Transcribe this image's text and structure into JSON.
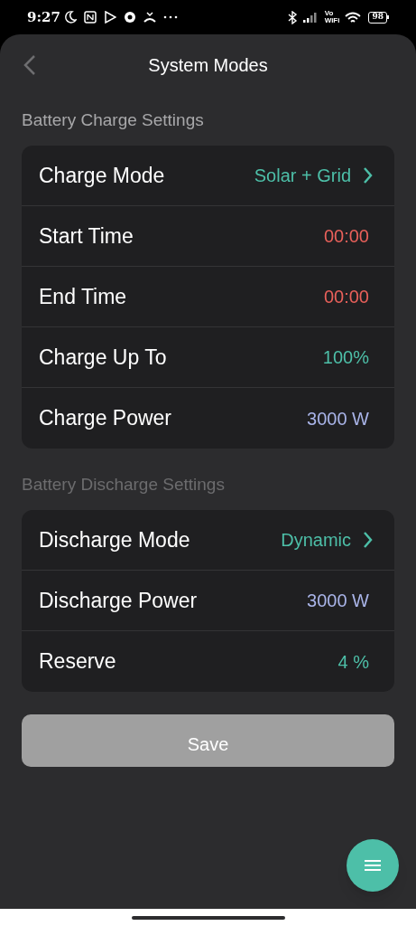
{
  "status_bar": {
    "time": "9:27",
    "volte": "Vo",
    "wifi_label": "WiFi",
    "battery": "98"
  },
  "header": {
    "title": "System Modes"
  },
  "sections": [
    {
      "title": "Battery Charge Settings",
      "dimmed": false,
      "rows": [
        {
          "kind": "nav",
          "label": "Charge Mode",
          "value": "Solar + Grid",
          "color": "#4dbfa8"
        },
        {
          "kind": "value",
          "label": "Start Time",
          "value": "00:00",
          "color": "#e8605a"
        },
        {
          "kind": "value",
          "label": "End Time",
          "value": "00:00",
          "color": "#e8605a"
        },
        {
          "kind": "value",
          "label": "Charge Up To",
          "value": "100%",
          "color": "#4dbfa8"
        },
        {
          "kind": "value",
          "label": "Charge Power",
          "value": "3000 W",
          "color": "#a9b4e8"
        }
      ]
    },
    {
      "title": "Battery Discharge Settings",
      "dimmed": true,
      "rows": [
        {
          "kind": "nav",
          "label": "Discharge Mode",
          "value": "Dynamic",
          "color": "#4dbfa8"
        },
        {
          "kind": "value",
          "label": "Discharge Power",
          "value": "3000 W",
          "color": "#a9b4e8"
        },
        {
          "kind": "value",
          "label": "Reserve",
          "value": "4 %",
          "color": "#4dbfa8"
        }
      ]
    }
  ],
  "save_button": {
    "label": "Save"
  }
}
